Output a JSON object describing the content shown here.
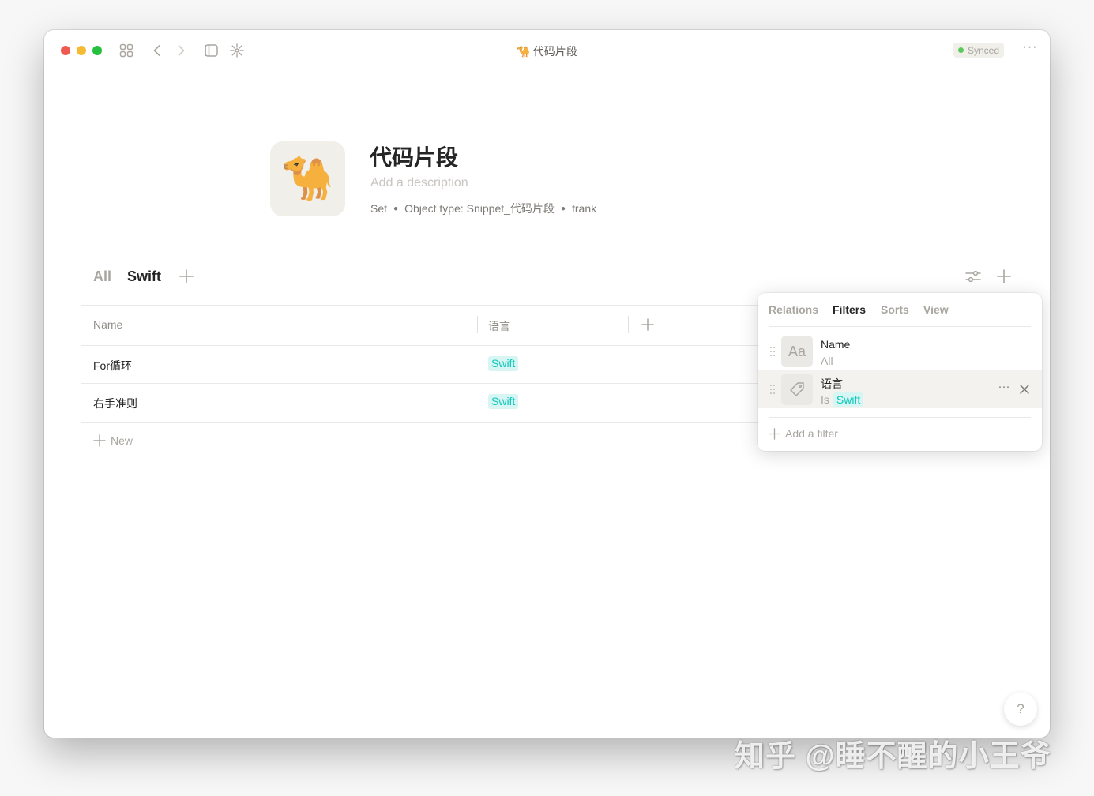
{
  "titlebar": {
    "title_icon": "🐪",
    "title": "代码片段",
    "sync_status": "Synced",
    "sync_color": "#5bc95b",
    "more_label": "···"
  },
  "object": {
    "icon": "🐪",
    "title": "代码片段",
    "description_placeholder": "Add a description",
    "meta": {
      "layout": "Set",
      "object_type": "Object type: Snippet_代码片段",
      "author": "frank"
    }
  },
  "views": {
    "tabs": [
      {
        "label": "All",
        "active": false
      },
      {
        "label": "Swift",
        "active": true
      }
    ]
  },
  "table": {
    "columns": [
      "Name",
      "语言"
    ],
    "rows": [
      {
        "name": "For循环",
        "tag": "Swift"
      },
      {
        "name": "右手准则",
        "tag": "Swift"
      }
    ],
    "new_label": "New",
    "tag_color": "#0fc8ba",
    "tag_bg": "#d6f5f3"
  },
  "popup": {
    "tabs": [
      "Relations",
      "Filters",
      "Sorts",
      "View"
    ],
    "active_tab": "Filters",
    "filters": [
      {
        "field": "Name",
        "icon": "text-icon",
        "icon_text": "Aa",
        "condition": "All"
      },
      {
        "field": "语言",
        "icon": "tag-icon",
        "condition": "Is",
        "value": "Swift"
      }
    ],
    "add_filter_label": "Add a filter"
  },
  "help_label": "?",
  "watermark": "知乎 @睡不醒的小王爷"
}
